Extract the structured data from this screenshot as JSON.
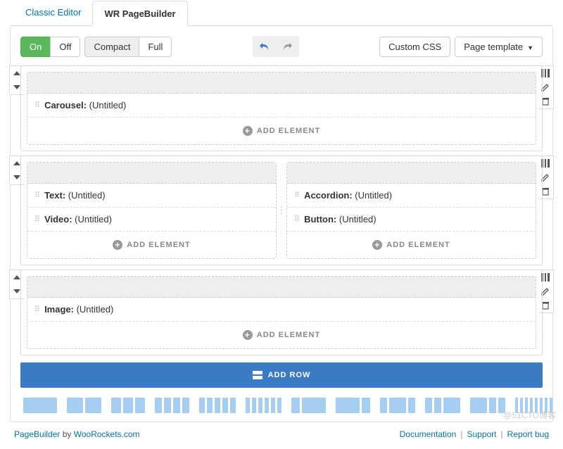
{
  "tabs": {
    "classic": "Classic Editor",
    "builder": "WR PageBuilder"
  },
  "toolbar": {
    "on": "On",
    "off": "Off",
    "compact": "Compact",
    "full": "Full",
    "custom_css": "Custom CSS",
    "page_template": "Page template"
  },
  "rows": [
    {
      "cols": [
        {
          "items": [
            {
              "type": "Carousel:",
              "title": "(Untitled)"
            }
          ]
        }
      ]
    },
    {
      "cols": [
        {
          "items": [
            {
              "type": "Text:",
              "title": "(Untitled)"
            },
            {
              "type": "Video:",
              "title": "(Untitled)"
            }
          ]
        },
        {
          "items": [
            {
              "type": "Accordion:",
              "title": "(Untitled)"
            },
            {
              "type": "Button:",
              "title": "(Untitled)"
            }
          ]
        }
      ]
    },
    {
      "cols": [
        {
          "items": [
            {
              "type": "Image:",
              "title": "(Untitled)"
            }
          ]
        }
      ]
    }
  ],
  "labels": {
    "add_element": "ADD ELEMENT",
    "add_row": "ADD ROW"
  },
  "layouts": [
    [
      48
    ],
    [
      23,
      23
    ],
    [
      14,
      14,
      14
    ],
    [
      10,
      10,
      10,
      10
    ],
    [
      8,
      8,
      8,
      8,
      8
    ],
    [
      6,
      6,
      6,
      6,
      6,
      6
    ],
    [
      12,
      34
    ],
    [
      34,
      12
    ],
    [
      10,
      24,
      10
    ],
    [
      10,
      10,
      24
    ],
    [
      24,
      10,
      10
    ],
    [
      4,
      4,
      4,
      4,
      4,
      4,
      4,
      4
    ]
  ],
  "footer": {
    "pagebuilder": "PageBuilder",
    "by": " by ",
    "woorockets": "WooRockets.com",
    "docs": "Documentation",
    "support": "Support",
    "report": "Report bug"
  },
  "watermark": "@51CTO博客"
}
